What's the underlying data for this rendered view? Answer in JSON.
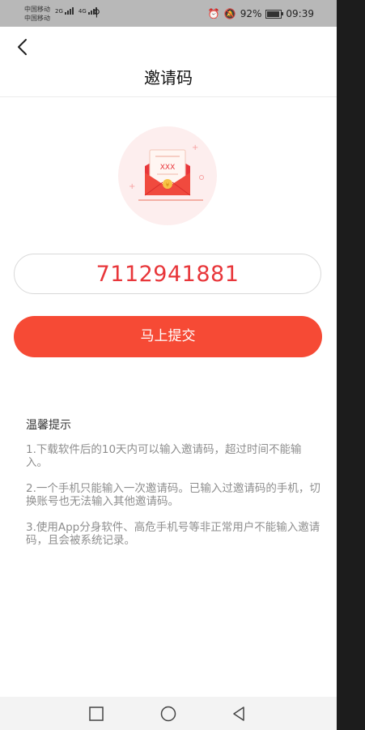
{
  "status_bar": {
    "carrier_1": "中国移动",
    "carrier_2": "中国移动",
    "network_1": "2G",
    "network_2": "4G",
    "battery_percent": "92%",
    "battery_level": 0.92,
    "time": "09:39"
  },
  "header": {
    "title": "邀请码"
  },
  "invite": {
    "envelope_text": "XXX",
    "code_value": "7112941881",
    "submit_label": "马上提交"
  },
  "tips": {
    "title": "温馨提示",
    "items": [
      "1.下载软件后的10天内可以输入邀请码，超过时间不能输入。",
      "2.一个手机只能输入一次邀请码。已输入过邀请码的手机，切换账号也无法输入其他邀请码。",
      "3.使用App分身软件、高危手机号等非正常用户不能输入邀请码，且会被系统记录。"
    ]
  },
  "colors": {
    "accent": "#f64a35",
    "code_text": "#e8363a",
    "tip_text": "#8e8e8e"
  },
  "icons": {
    "back": "chevron-left-icon",
    "envelope": "red-envelope-icon",
    "nav_recent": "square-icon",
    "nav_home": "circle-icon",
    "nav_back": "triangle-back-icon"
  }
}
